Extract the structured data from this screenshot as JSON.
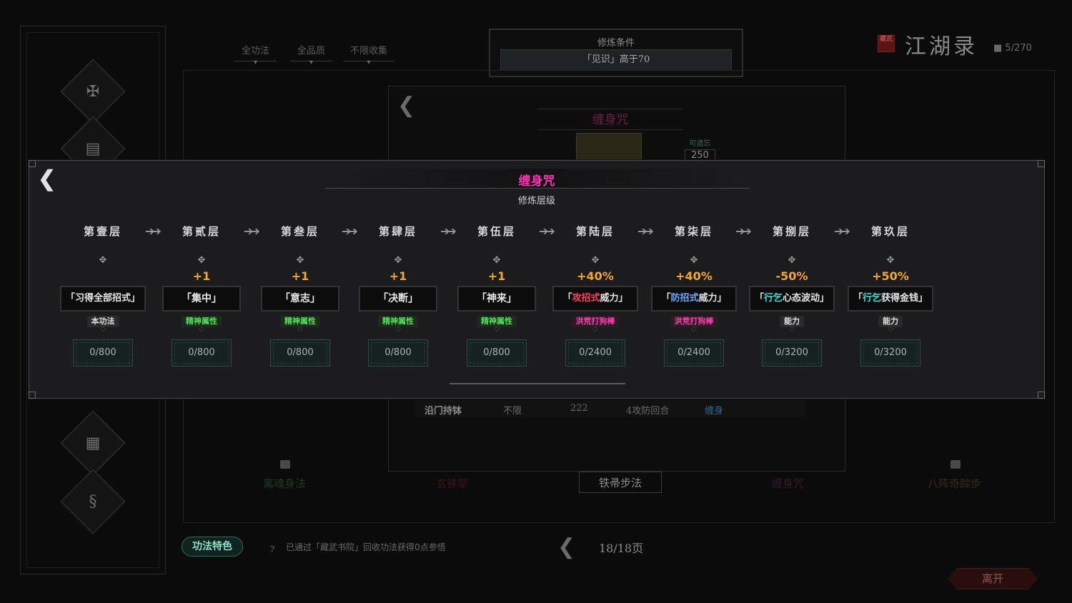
{
  "filters": [
    {
      "label": "全功法"
    },
    {
      "label": "全品质"
    },
    {
      "label": "不限收集"
    }
  ],
  "condition": {
    "title": "修炼条件",
    "value": "「见识」高于70"
  },
  "header": {
    "title": "江湖录",
    "count": "5/270",
    "seal_text": "藏武"
  },
  "book": {
    "title": "缠身咒",
    "forget_label": "可遗忘",
    "forget_value": "250"
  },
  "bg_row": {
    "col1": "沿门持钵",
    "col2": "不限",
    "col3": "222",
    "col4": "4攻防回合",
    "col5": "缠身"
  },
  "bg_books": [
    "离魂身法",
    "玄铁掌",
    "铁帚步法",
    "缠身咒",
    "八阵奇踪步"
  ],
  "bottom": {
    "feature_label": "功法特色",
    "note": "已通过「藏武书院」回收功法获得0点参悟",
    "page": "18/18页",
    "leave_label": "离开"
  },
  "modal": {
    "title": "缠身咒",
    "subtitle": "修炼层级",
    "layers": [
      {
        "name": "第壹层",
        "bonus": "",
        "effect": "「习得全部招式」",
        "tag": "本功法",
        "progress": "0/800"
      },
      {
        "name": "第贰层",
        "bonus": "+1",
        "effect": "「集中」",
        "tag": "精神属性",
        "progress": "0/800"
      },
      {
        "name": "第叁层",
        "bonus": "+1",
        "effect": "「意志」",
        "tag": "精神属性",
        "progress": "0/800"
      },
      {
        "name": "第肆层",
        "bonus": "+1",
        "effect": "「决断」",
        "tag": "精神属性",
        "progress": "0/800"
      },
      {
        "name": "第伍层",
        "bonus": "+1",
        "effect": "「神来」",
        "tag": "精神属性",
        "progress": "0/800"
      },
      {
        "name": "第陆层",
        "bonus": "+40%",
        "effect_prefix": "「",
        "effect_core": "攻招式",
        "effect_suffix": "威力」",
        "tag": "洪荒打狗棒",
        "progress": "0/2400"
      },
      {
        "name": "第柒层",
        "bonus": "+40%",
        "effect_prefix": "「",
        "effect_core": "防招式",
        "effect_suffix": "威力」",
        "tag": "洪荒打狗棒",
        "progress": "0/2400"
      },
      {
        "name": "第捌层",
        "bonus": "-50%",
        "effect_prefix": "「",
        "effect_core": "行乞",
        "effect_suffix": "心态波动」",
        "tag": "能力",
        "progress": "0/3200"
      },
      {
        "name": "第玖层",
        "bonus": "+50%",
        "effect_prefix": "「",
        "effect_core": "行乞",
        "effect_suffix": "获得金钱」",
        "tag": "能力",
        "progress": "0/3200"
      }
    ]
  },
  "colors": {
    "title_magenta": "#ff2fb8",
    "bonus_orange": "#f0a830",
    "tag_green": "#4fe05a",
    "tag_pink": "#ff3fb4",
    "core_red": "#ff4060",
    "core_blue": "#6aa8ff",
    "core_cyan": "#3ae0e0"
  }
}
